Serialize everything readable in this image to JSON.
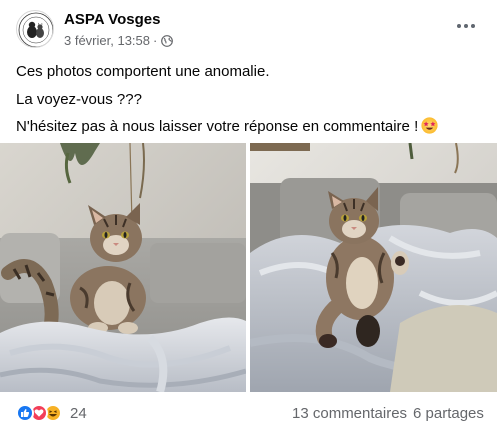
{
  "post": {
    "page_name": "ASPA Vosges",
    "timestamp": "3 février, 13:58",
    "separator": "·",
    "privacy_icon": "globe-icon",
    "more_icon": "more-options-icon",
    "avatar_logo_text": "ASPA VOSGES",
    "text_lines": [
      "Ces photos comportent une anomalie.",
      "La voyez-vous ???",
      "N'hésitez pas à nous laisser votre réponse en commentaire !"
    ],
    "text_emoji": "star-struck-emoji-icon"
  },
  "photos": [
    {
      "subject": "kitten-sitting-on-blanket-left"
    },
    {
      "subject": "kitten-sitting-on-blanket-right"
    }
  ],
  "footer": {
    "reaction_icons": [
      "like-icon",
      "love-icon",
      "haha-icon"
    ],
    "reaction_count": "24",
    "comments": "13 commentaires",
    "shares": "6 partages"
  },
  "colors": {
    "text_primary": "#050505",
    "text_secondary": "#65676b",
    "like_blue": "#1877f2",
    "love_red": "#f33e58",
    "haha_yellow": "#f7b125"
  }
}
